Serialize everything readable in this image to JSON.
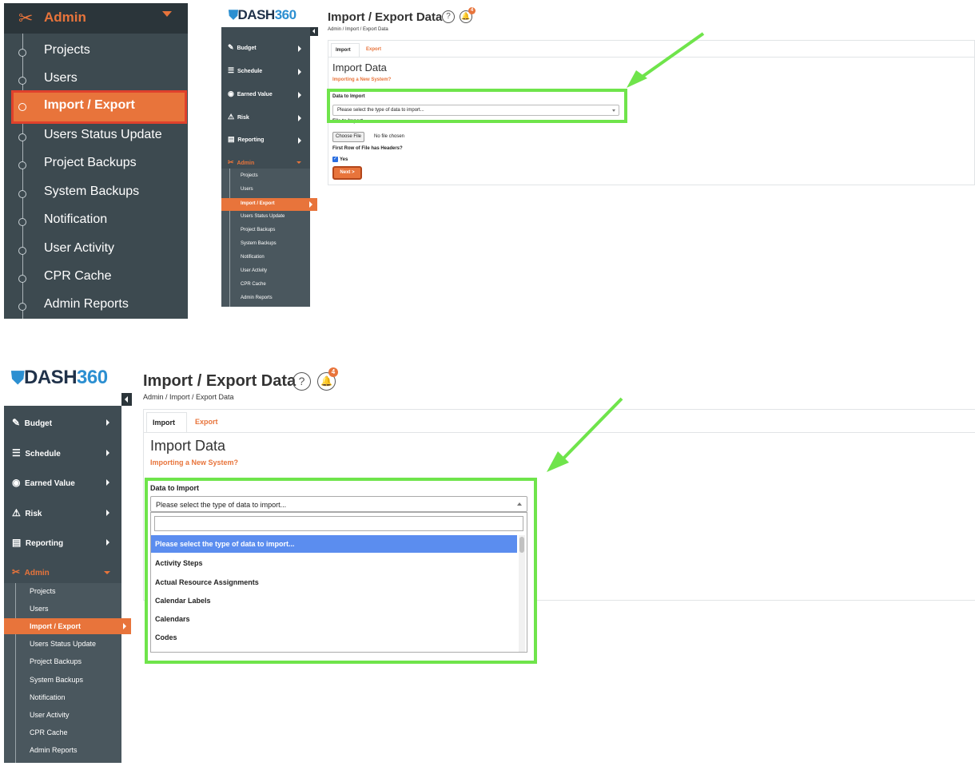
{
  "zoom_sidebar": {
    "header": {
      "label": "Admin",
      "icon": "tools-icon"
    },
    "items": [
      {
        "label": "Projects"
      },
      {
        "label": "Users"
      },
      {
        "label": "Import / Export",
        "active": true
      },
      {
        "label": "Users Status Update"
      },
      {
        "label": "Project Backups"
      },
      {
        "label": "System Backups"
      },
      {
        "label": "Notification"
      },
      {
        "label": "User Activity"
      },
      {
        "label": "CPR Cache"
      },
      {
        "label": "Admin Reports"
      }
    ]
  },
  "app": {
    "logo_prefix": "DASH",
    "logo_suffix": "360",
    "page_title": "Import / Export Data",
    "help_glyph": "?",
    "notification_count": "4",
    "breadcrumb": "Admin / Import / Export Data",
    "nav": [
      {
        "label": "Budget",
        "icon": "edit-icon"
      },
      {
        "label": "Schedule",
        "icon": "list-indent-icon"
      },
      {
        "label": "Earned Value",
        "icon": "gauge-icon"
      },
      {
        "label": "Risk",
        "icon": "warning-icon"
      },
      {
        "label": "Reporting",
        "icon": "report-icon"
      },
      {
        "label": "Admin",
        "icon": "tools-icon"
      }
    ],
    "admin_sub": [
      "Projects",
      "Users",
      "Import / Export",
      "Users Status Update",
      "Project Backups",
      "System Backups",
      "Notification",
      "User Activity",
      "CPR Cache",
      "Admin Reports"
    ],
    "tabs": {
      "import": "Import",
      "export": "Export"
    },
    "section_title": "Import Data",
    "section_link": "Importing a New System?",
    "data_label": "Data to Import",
    "select_placeholder": "Please select the type of data to import...",
    "file_label": "File to Import",
    "choose_file": "Choose File",
    "no_file": "No file chosen",
    "headers_label": "First Row of File has Headers?",
    "yes_label": "Yes",
    "next_button": "Next >",
    "dropdown_options": [
      "Please select the type of data to import...",
      "Activity Steps",
      "Actual Resource Assignments",
      "Calendar Labels",
      "Calendars",
      "Codes"
    ]
  },
  "colors": {
    "accent": "#e8743b",
    "sidebar": "#3f4c53",
    "highlight": "#6fe44b",
    "selected_option": "#5b8def"
  }
}
